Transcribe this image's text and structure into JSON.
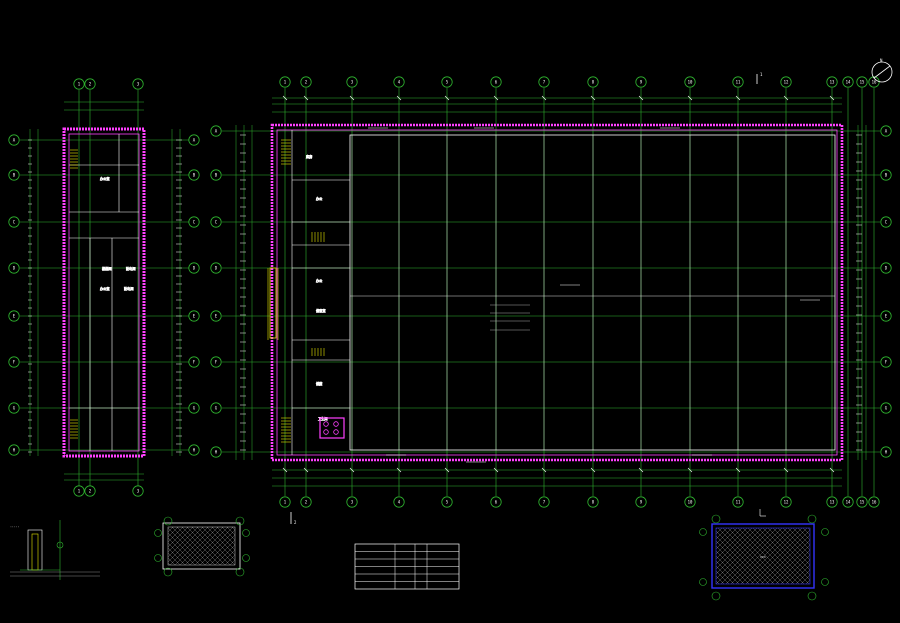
{
  "drawing": {
    "north_arrow_label": "N",
    "section_mark_label": "1",
    "section_mark_bottom": "2",
    "left_plan": {
      "grid_columns": [
        "1",
        "2",
        "3"
      ],
      "grid_rows": [
        "A",
        "B",
        "C",
        "D",
        "E",
        "F",
        "G",
        "H"
      ],
      "room_labels": [
        "办公室",
        "楼梯间",
        "配电间"
      ]
    },
    "main_plan": {
      "grid_columns": [
        "1",
        "2",
        "3",
        "4",
        "5",
        "6",
        "7",
        "8",
        "9",
        "10",
        "11",
        "12",
        "13",
        "14",
        "15",
        "16"
      ],
      "grid_rows": [
        "A",
        "B",
        "C",
        "D",
        "E",
        "F",
        "G",
        "H"
      ],
      "room_labels": [
        "库房",
        "办公",
        "楼梯",
        "卫生间",
        "值班室",
        "储藏"
      ]
    },
    "legend_table": {
      "rows": [
        [
          "",
          "",
          ""
        ],
        [
          "",
          "",
          ""
        ],
        [
          "",
          "",
          ""
        ],
        [
          "",
          "",
          ""
        ],
        [
          "",
          "",
          ""
        ],
        [
          "",
          "",
          ""
        ]
      ]
    }
  },
  "colors": {
    "background": "#000000",
    "grid": "#2fb52f",
    "wall": "#ff40ff",
    "white": "#ffffff",
    "accent_yellow": "#e8e800",
    "accent_blue": "#3333ff",
    "cyan": "#00ffff"
  }
}
